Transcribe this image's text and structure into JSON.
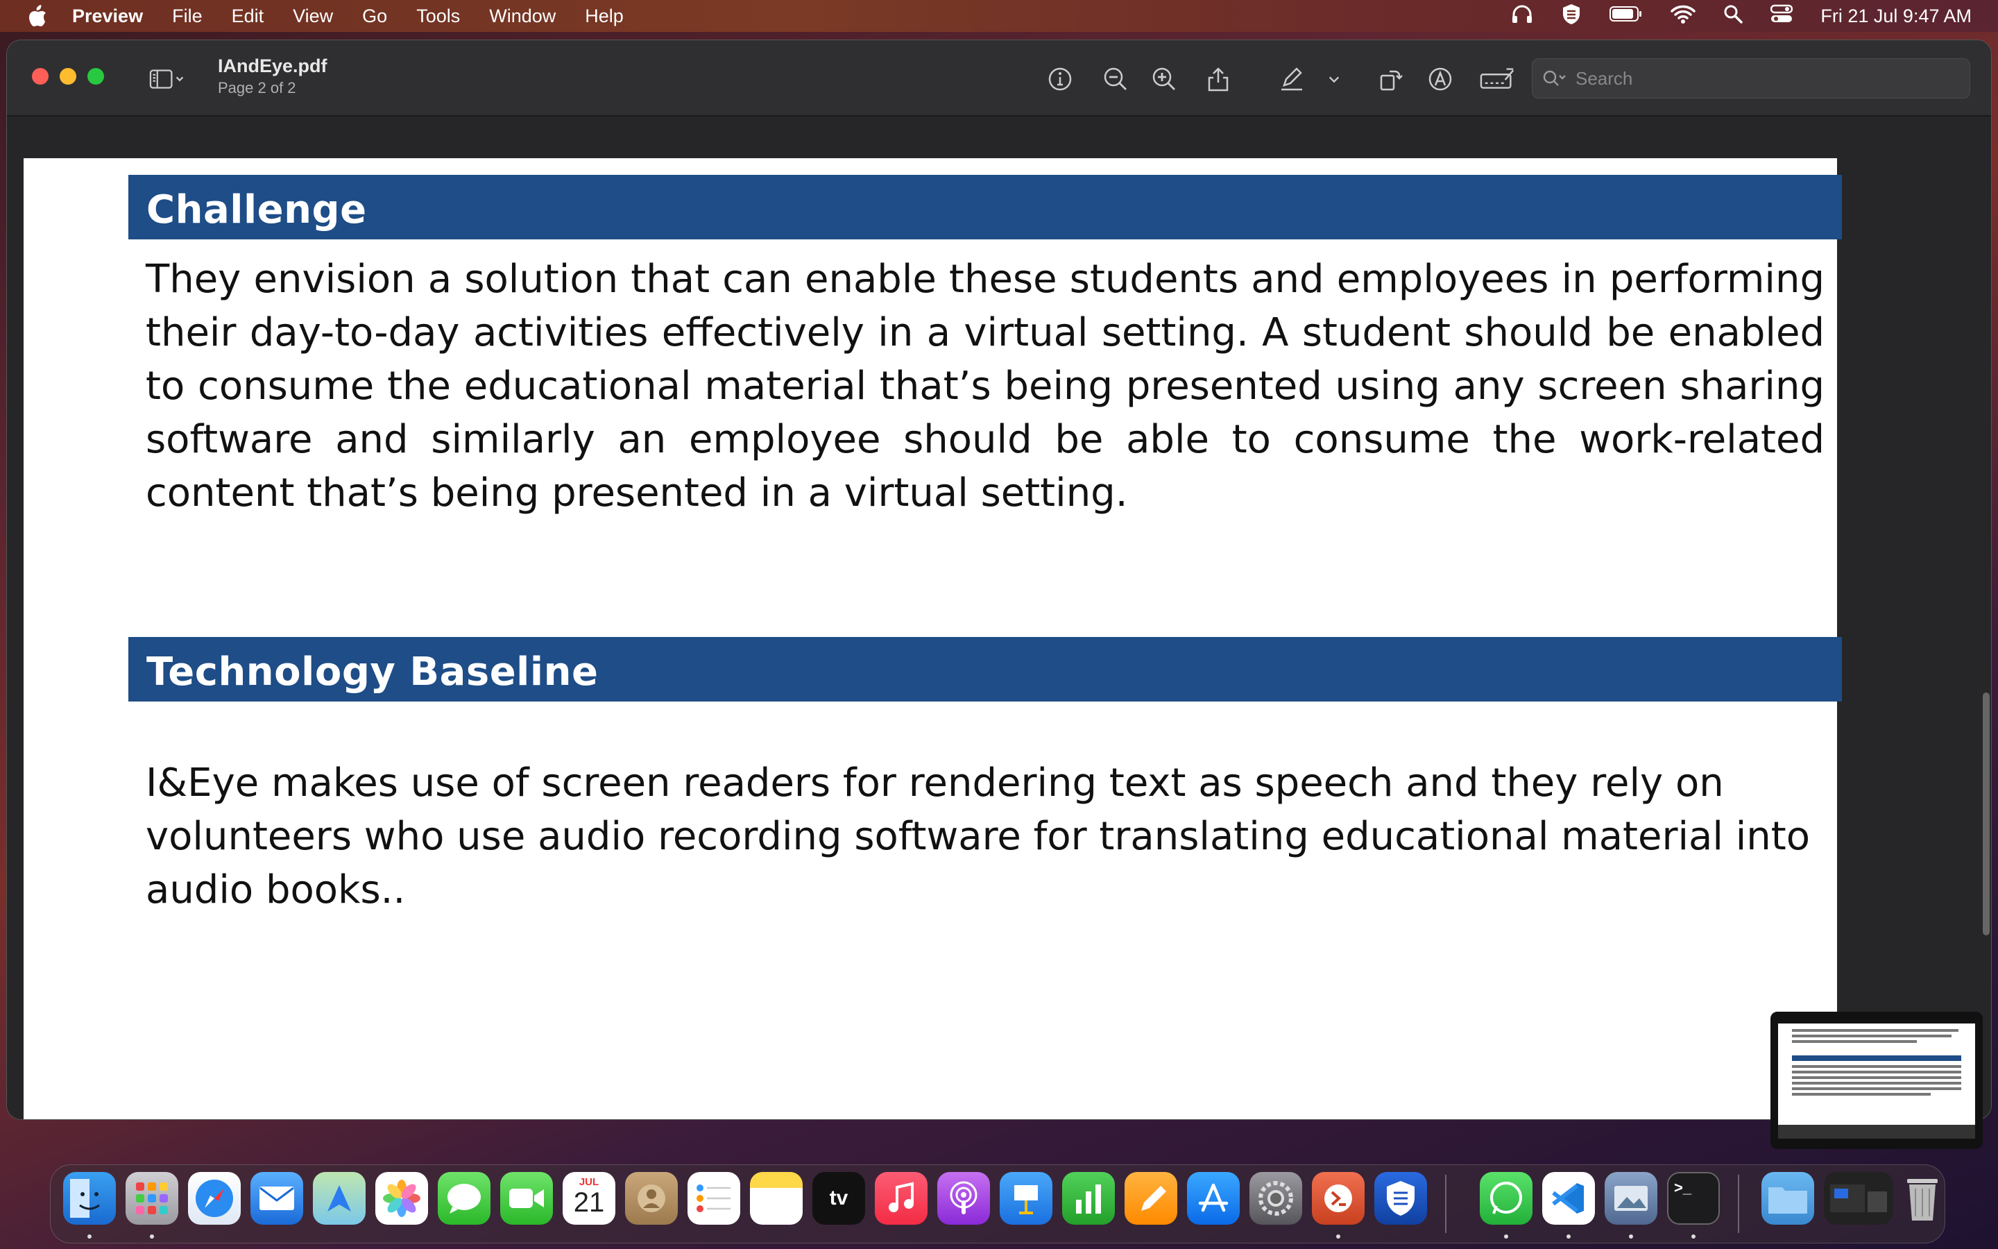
{
  "menubar": {
    "app_name": "Preview",
    "items": [
      "File",
      "Edit",
      "View",
      "Go",
      "Tools",
      "Window",
      "Help"
    ],
    "clock": "Fri 21 Jul  9:47 AM"
  },
  "window": {
    "title": "IAndEye.pdf",
    "subtitle": "Page 2 of 2",
    "search_placeholder": "Search"
  },
  "document": {
    "sections": [
      {
        "heading": "Challenge",
        "body": "They envision a solution that can enable these students and employees in performing their day-to-day activities effectively in a virtual setting. A student should be enabled to consume the educational material that’s being presented using any screen sharing software and similarly an employee should be able to consume the work-related content that’s being presented in a virtual setting."
      },
      {
        "heading": "Technology Baseline",
        "body": "I&Eye makes use of screen readers for rendering text as speech and they rely on volunteers who use audio recording software for translating educational material into audio books.."
      }
    ]
  },
  "dock": {
    "calendar_month": "JUL",
    "calendar_day": "21",
    "tv_label": "tv",
    "terminal_prompt": ">_"
  },
  "colors": {
    "section_bar": "#1e4d87",
    "close": "#ff5f57",
    "minimize": "#febc2e",
    "zoom": "#28c840"
  }
}
